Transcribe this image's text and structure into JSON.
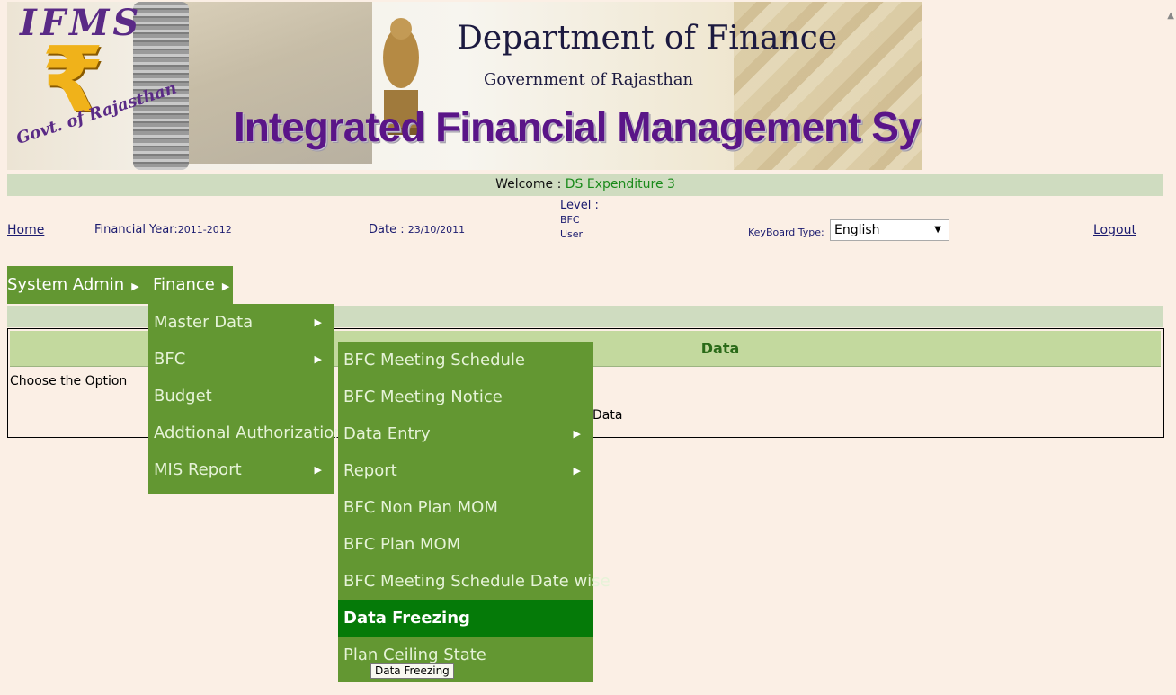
{
  "banner": {
    "logo_text": "IFMS",
    "logo_rupee": "₹",
    "logo_subtext": "Govt. of Rajasthan",
    "department": "Department of Finance",
    "government": "Government of Rajasthan",
    "system_title": "Integrated Financial Management System"
  },
  "welcome": {
    "label": "Welcome : ",
    "user": "DS Expenditure 3"
  },
  "info": {
    "home": "Home",
    "fy_label": "Financial Year:",
    "fy_value": "2011-2012",
    "date_label": "Date : ",
    "date_value": "23/10/2011",
    "level_label": "Level :",
    "level_value1": "BFC",
    "level_value2": "User",
    "keyboard_label": "KeyBoard Type:",
    "keyboard_value": "English",
    "logout": "Logout"
  },
  "menubar": {
    "system_admin": "System Admin",
    "finance": "Finance"
  },
  "finance_submenu": [
    "Master Data",
    "BFC",
    "Budget",
    "Addtional Authorization",
    "MIS Report"
  ],
  "bfc_submenu": [
    "BFC Meeting Schedule",
    "BFC Meeting Notice",
    "Data Entry",
    "Report",
    "BFC Non Plan MOM",
    "BFC Plan MOM",
    "BFC Meeting Schedule Date wise",
    "Data Freezing",
    "Plan Ceiling State"
  ],
  "main": {
    "header": "Data",
    "choose_option": "Choose the Option",
    "data_text": "Data"
  },
  "tooltip": "Data Freezing",
  "colors": {
    "menu_green": "#639732",
    "active_green": "#057a08",
    "header_green": "#c3d99e",
    "background": "#fbefe5",
    "title_purple": "#5a1588"
  }
}
